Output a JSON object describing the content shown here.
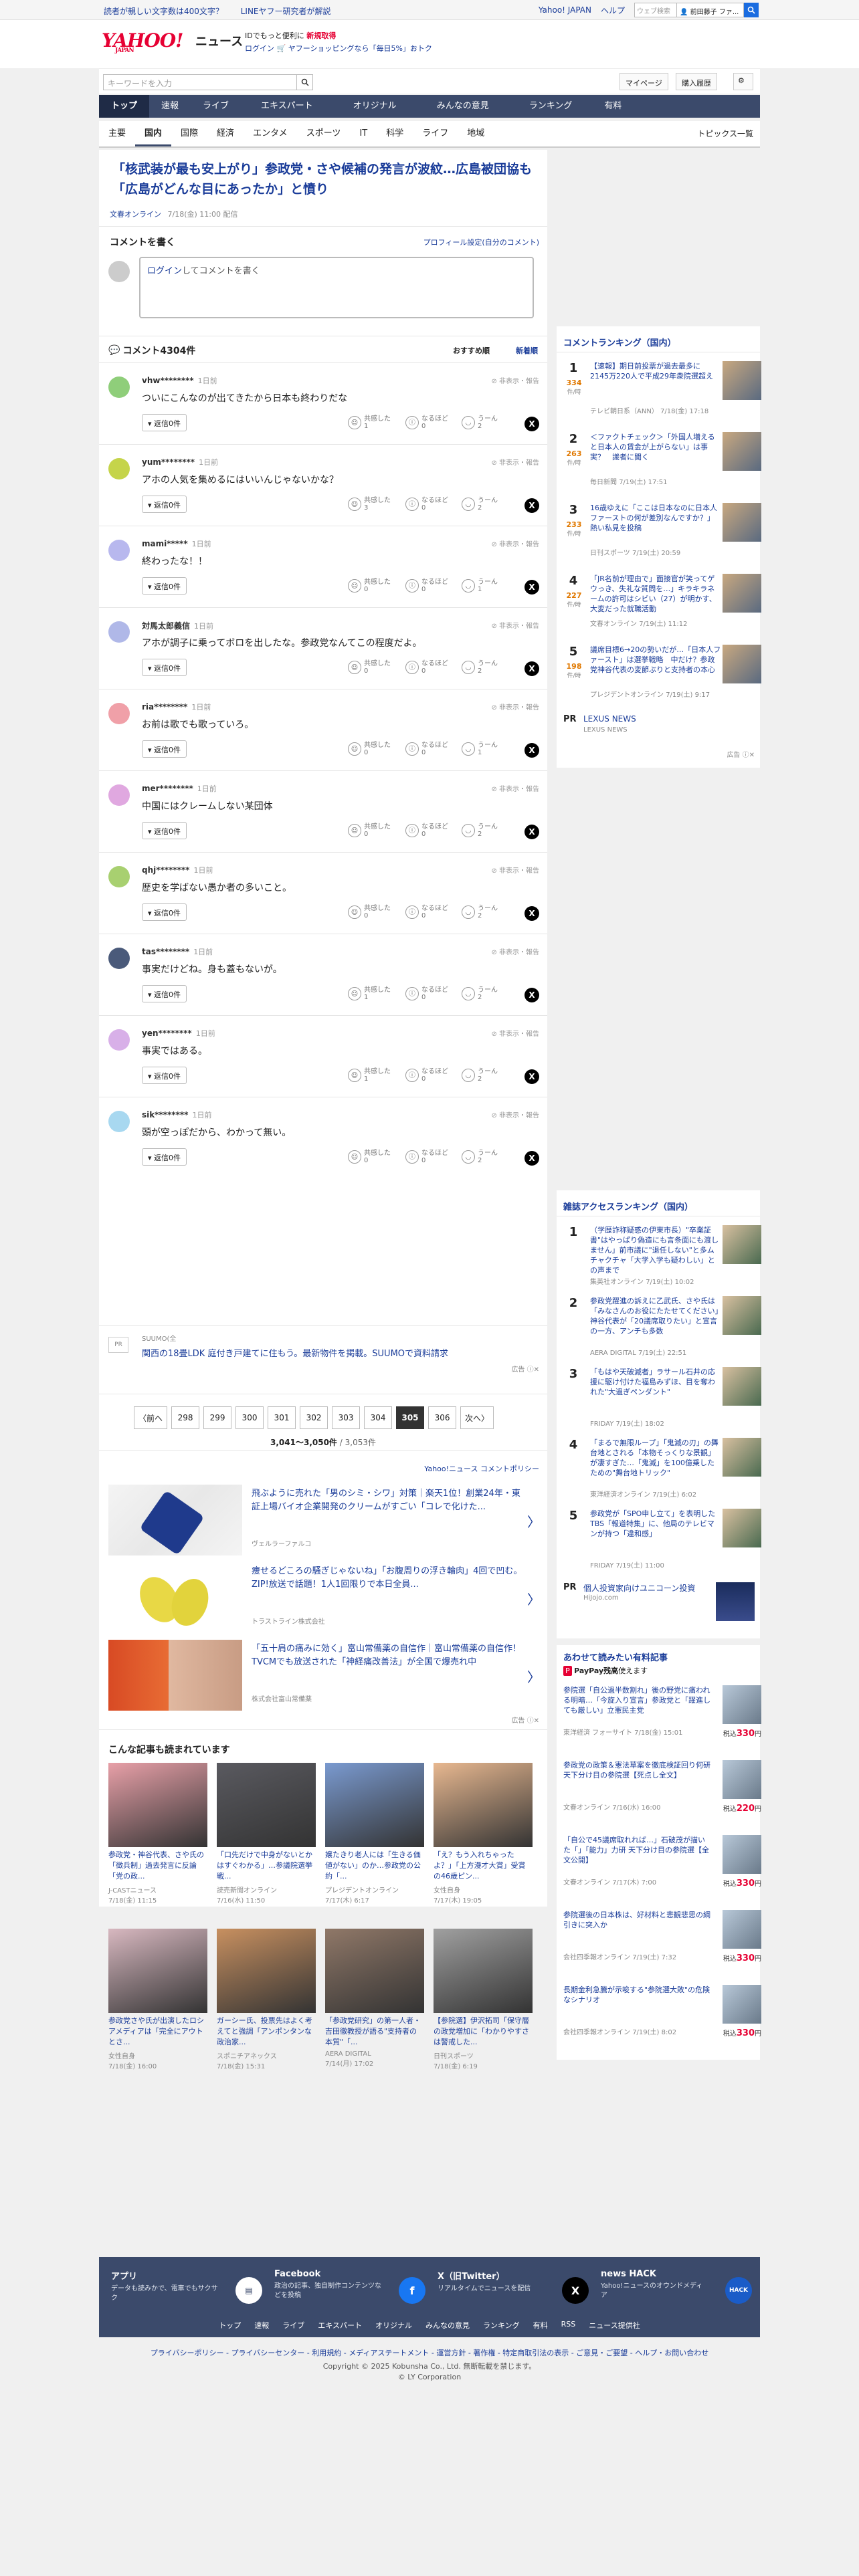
{
  "topbar": {
    "promos": [
      "読者が親しい文字数は400文字？",
      "LINEヤフー研究者が解説"
    ],
    "links": [
      "Yahoo! JAPAN",
      "ヘルプ"
    ],
    "search_placeholder": "ウェブ検索",
    "user_name": "前田藤子 ファ..."
  },
  "header": {
    "logo": "YAHOO!",
    "logo_sub": "JAPAN",
    "section": "ニュース",
    "line1_a": "IDでもっと便利に",
    "line1_b": "新規取得",
    "line2_a": "ログイン",
    "line2_b": "ヤフーショッピングなら「毎日5%」おトク"
  },
  "search": {
    "placeholder": "キーワードを入力",
    "mypage": "マイページ",
    "history": "購入履歴"
  },
  "gnav": [
    "トップ",
    "速報",
    "ライブ",
    "エキスパート",
    "オリジナル",
    "みんなの意見",
    "ランキング",
    "有料"
  ],
  "snav": [
    "主要",
    "国内",
    "国際",
    "経済",
    "エンタメ",
    "スポーツ",
    "IT",
    "科学",
    "ライフ",
    "地域"
  ],
  "snav_topics": "トピックス一覧",
  "article": {
    "title": "「核武装が最も安上がり」参政党・さや候補の発言が波紋…広島被団協も「広島がどんな目にあったか」と憤り",
    "source": "文春オンライン",
    "date": "7/18(金) 11:00 配信"
  },
  "comment_section": {
    "heading": "コメントを書く",
    "profile_link": "プロフィール設定(自分のコメント)",
    "login": "ログイン",
    "write_prompt": "してコメントを書く",
    "count_label": "コメント4304件",
    "sort_recommended": "おすすめ順",
    "sort_new": "新着順",
    "hidden_label": "非表示・報告",
    "reply_label": "返信0件",
    "react_labels": [
      "共感した",
      "なるほど",
      "うーん"
    ],
    "x_label": "X"
  },
  "comments": [
    {
      "user": "vhw********",
      "time": "1日前",
      "text": "ついにこんなのが出てきたから日本も終わりだな",
      "counts": [
        "1",
        "0",
        "2"
      ],
      "color": "#8fce7a"
    },
    {
      "user": "yum********",
      "time": "1日前",
      "text": "アホの人気を集めるにはいいんじゃないかな？",
      "counts": [
        "3",
        "0",
        "2"
      ],
      "color": "#c5d44a"
    },
    {
      "user": "mami*****",
      "time": "1日前",
      "text": "終わったな！！",
      "counts": [
        "0",
        "0",
        "1"
      ],
      "color": "#b8b8ee"
    },
    {
      "user": "対馬太郎義信",
      "time": "1日前",
      "text": "アホが調子に乗ってボロを出したな。参政党なんてこの程度だよ。",
      "counts": [
        "0",
        "0",
        "2"
      ],
      "color": "#b0b8e8"
    },
    {
      "user": "ria********",
      "time": "1日前",
      "text": "お前は歌でも歌っていろ。",
      "counts": [
        "0",
        "0",
        "1"
      ],
      "color": "#f0a0a8"
    },
    {
      "user": "mer********",
      "time": "1日前",
      "text": "中国にはクレームしない某団体",
      "counts": [
        "0",
        "0",
        "2"
      ],
      "color": "#e0a8e0"
    },
    {
      "user": "qhj********",
      "time": "1日前",
      "text": "歴史を学ばない愚か者の多いこと。",
      "counts": [
        "0",
        "0",
        "2"
      ],
      "color": "#a8d070"
    },
    {
      "user": "tas********",
      "time": "1日前",
      "text": "事実だけどね。身も蓋もないが。",
      "counts": [
        "1",
        "0",
        "2"
      ],
      "color": "#4a5a7a"
    },
    {
      "user": "yen********",
      "time": "1日前",
      "text": "事実ではある。",
      "counts": [
        "1",
        "0",
        "2"
      ],
      "color": "#d8b0e8"
    },
    {
      "user": "sik********",
      "time": "1日前",
      "text": "頭が空っぽだから、わかって無い。",
      "counts": [
        "0",
        "0",
        "2"
      ],
      "color": "#a8d8f0"
    }
  ],
  "inline_ad": {
    "sponsor": "SUUMO(全",
    "text": "関西の18畳LDK 庭付き戸建てに住もう。最新物件を掲載。SUUMOで資料請求",
    "label": "広告"
  },
  "pagination": {
    "prev": "〈前へ",
    "pages": [
      "298",
      "299",
      "300",
      "301",
      "302",
      "303",
      "304",
      "305",
      "306"
    ],
    "current": "305",
    "next": "次へ〉",
    "range": "3,041〜3,050件",
    "total": "/ 3,053件",
    "policy": "Yahoo!ニュース コメントポリシー"
  },
  "ads": [
    {
      "title": "飛ぶように売れた「男のシミ・シワ」対策｜楽天1位！創業24年・東証上場バイオ企業開発のクリームがすごい「コレで化けた...",
      "sponsor": "ヴェルラーファルコ"
    },
    {
      "title": "痩せるどころの騒ぎじゃないね」「お腹周りの浮き輪肉」4回で凹む。ZIP!放送で話題！1人1回限りで本日全員...",
      "sponsor": "トラストライン株式会社"
    },
    {
      "title": "「五十肩の痛みに効く」富山常備薬の自信作｜富山常備薬の自信作！TVCMでも放送された「神経痛改善法」が全国で爆売れ中",
      "sponsor": "株式会社富山常備薬"
    }
  ],
  "ad_label": "広告",
  "also_read": {
    "heading": "こんな記事も読まれています",
    "items": [
      {
        "title": "参政党・神谷代表、さや氏の「徴兵制」過去発言に反論「党の政...",
        "source": "J-CASTニュース",
        "date": "7/18(金) 11:15"
      },
      {
        "title": "「口先だけで中身がないとかはすぐわかる」…参議院選挙戦...",
        "source": "読売新聞オンライン",
        "date": "7/16(水) 11:50"
      },
      {
        "title": "嬢たきり老人には「生きる価値がない」のか…参政党の公約「...",
        "source": "プレジデントオンライン",
        "date": "7/17(木) 6:17"
      },
      {
        "title": "「え？もう入れちゃったよ？」「上方漫才大賞」受賞の46歳ピン...",
        "source": "女性自身",
        "date": "7/17(木) 19:05"
      },
      {
        "title": "参政党さや氏が出演したロシアメディアは「完全にアウトとさ...",
        "source": "女性自身",
        "date": "7/18(金) 16:00"
      },
      {
        "title": "ガーシー氏、投票先はよく考えてと強調「アンポンタンな政治家...",
        "source": "スポニチアネックス",
        "date": "7/18(金) 15:31"
      },
      {
        "title": "「参政党研究」の第一人者・吉田徹教授が語る\"支持者の本質\"「...",
        "source": "AERA DIGITAL",
        "date": "7/14(月) 17:02"
      },
      {
        "title": "【参院選】伊沢拓司「保守層の政党増加に「わかりやすさは警戒した...",
        "source": "日刊スポーツ",
        "date": "7/18(金) 6:19"
      }
    ]
  },
  "ranking": {
    "heading": "コメントランキング（国内）",
    "unit": "件/時",
    "items": [
      {
        "n": "1",
        "cnt": "334",
        "title": "【速報】期日前投票が過去最多に　2145万220人で平成29年衆院選超え",
        "source": "テレビ朝日系（ANN）",
        "date": "7/18(金) 17:18"
      },
      {
        "n": "2",
        "cnt": "263",
        "title": "＜ファクトチェック＞「外国人増えると日本人の賃金が上がらない」は事実？　識者に聞く",
        "source": "毎日新聞",
        "date": "7/19(土) 17:51"
      },
      {
        "n": "3",
        "cnt": "233",
        "title": "16歳ゆえに「ここは日本なのに日本人ファーストの何が差別なんですか？」熱い私見を投稿",
        "source": "日刊スポーツ",
        "date": "7/19(土) 20:59"
      },
      {
        "n": "4",
        "cnt": "227",
        "title": "「JR名前が理由で」面接官が笑ってゲウっき、失礼な質問を…」キラキラネームの許可はシビい（27）が明かす、大変だった就職活動",
        "source": "文春オンライン",
        "date": "7/19(土) 11:12"
      },
      {
        "n": "5",
        "cnt": "198",
        "title": "議席目標6→20の勢いだが…「日本人ファースト」は選挙戦略　中だけ？参政党神谷代表の変節ぶりと支持者の本心",
        "source": "プレジデントオンライン",
        "date": "7/19(土) 9:17"
      }
    ],
    "pr_label": "PR",
    "pr_title": "LEXUS NEWS",
    "pr_sub": "LEXUS NEWS"
  },
  "ranking2": {
    "heading": "雑誌アクセスランキング（国内）",
    "items": [
      {
        "n": "1",
        "title": "（学歴詐称疑惑の伊東市長）\"卒業証書\"はやっぱり偽造にも言条面にも渡しません」前市議に\"退任しない\"と多ムチャクチャ「大学入学も疑わしい」との声まで",
        "source": "集英社オンライン",
        "date": "7/19(土) 10:02"
      },
      {
        "n": "2",
        "title": "参政党躍進の訴えに乙武氏、さや氏は「みなさんのお役にたたせてください」神谷代表が「20議席取りたい」と宣言の一方、アンチも多数",
        "source": "AERA DIGITAL",
        "date": "7/19(土) 22:51"
      },
      {
        "n": "3",
        "title": "「もはや天破滅者」ラサール石井の応援に駆け付けた福島みずほ、目を奪われた\"大過ぎペンダント\"",
        "source": "FRIDAY",
        "date": "7/19(土) 18:02"
      },
      {
        "n": "4",
        "title": "「まるで無限ループ」「鬼滅の刃」の舞台地とされる「本物そっくりな景観」が凄すぎた…「鬼滅」を100億乗したための\"舞台地トリック\"",
        "source": "東洋経済オンライン",
        "date": "7/19(土) 6:02"
      },
      {
        "n": "5",
        "title": "参政党が「SPO申し立て」を表明したTBS「報道特集」に、他局のテレビマンが持つ「違和感」",
        "source": "FRIDAY",
        "date": "7/19(土) 11:00"
      }
    ],
    "pr_label": "PR",
    "pr_title": "個人投資家向けユニコーン投資",
    "pr_sub": "HiJojo.com"
  },
  "paid": {
    "heading": "あわせて読みたい有料記事",
    "paypay": "PayPay残高",
    "paypay_sub": "使えます",
    "items": [
      {
        "title": "参院選「自公過半数割れ」後の野党に痛われる明暗…「今旋入り宣言」参政党と「躍進しても厳しい」立憲民主党",
        "source": "東洋経済 フォーサイト",
        "date": "7/18(金) 15:01",
        "price": "330"
      },
      {
        "title": "参政党の政策＆憲法草案を徹底検証回り何研 天下分け目の参院選【死点し全文】",
        "source": "文春オンライン",
        "date": "7/16(水) 16:00",
        "price": "220"
      },
      {
        "title": "「自公で45議席取れれば…」石破茂が描いた「」「能力」力研 天下分け目の参院選【全文公開】",
        "source": "文春オンライン",
        "date": "7/17(木) 7:00",
        "price": "330"
      },
      {
        "title": "参院選後の日本株は、好材料と悲観悲思の綱引きに突入か",
        "source": "会社四季報オンライン",
        "date": "7/19(土) 7:32",
        "price": "330"
      },
      {
        "title": "長期金利急騰が示唆する\"参院選大敗\"の危険なシナリオ",
        "source": "会社四季報オンライン",
        "date": "7/19(土) 8:02",
        "price": "330"
      }
    ],
    "price_prefix": "税込",
    "price_suffix": "円"
  },
  "footer": {
    "boxes": [
      {
        "h": "アプリ",
        "d": "データも読みかで、電車でもサクサク"
      },
      {
        "h": "Facebook",
        "d": "政治の記事、独自制作コンテンツなどを投稿"
      },
      {
        "h": "X（旧Twitter）",
        "d": "リアルタイムでニュースを配信"
      },
      {
        "h": "news HACK",
        "d": "Yahoo!ニュースのオウンドメディア"
      }
    ],
    "links": [
      "トップ",
      "速報",
      "ライブ",
      "エキスパート",
      "オリジナル",
      "みんなの意見",
      "ランキング",
      "有料",
      "RSS",
      "ニュース提供社"
    ],
    "legal": "プライバシーポリシー - プライバシーセンター - 利用規約 - メディアステートメント - 運営方針 - 著作権 - 特定商取引法の表示 - ご意見・ご要望 - ヘルプ・お問い合わせ",
    "copy1": "Copyright © 2025 Kobunsha Co., Ltd. 無断転載を禁じます。",
    "copy2": "© LY Corporation"
  },
  "colors": {
    "accent": "#1a3c99",
    "nav": "#3b4a6b",
    "brand_red": "#e60033",
    "count_orange": "#e07800"
  }
}
